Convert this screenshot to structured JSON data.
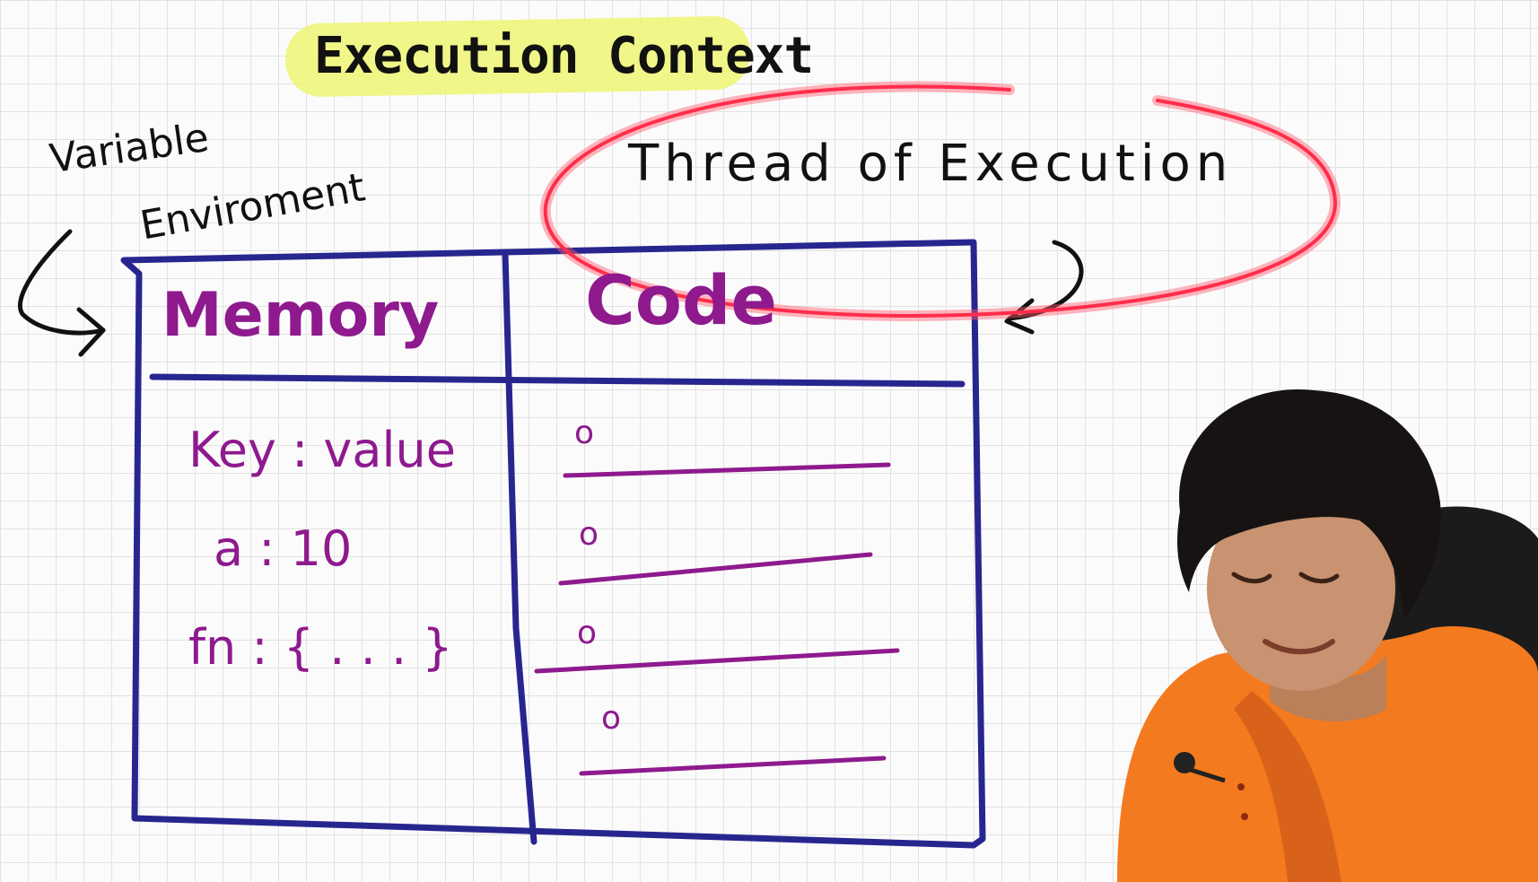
{
  "title": "Execution Context",
  "variable_environment": {
    "line1": "Variable",
    "line2": "Enviroment"
  },
  "thread_of_execution": "Thread of Execution",
  "table": {
    "memory_header": "Memory",
    "code_header": "Code",
    "memory_rows": [
      "Key : value",
      "a : 10",
      "fn : { . . . }"
    ],
    "code_markers": [
      "o",
      "o",
      "o",
      "o"
    ]
  },
  "colors": {
    "ink_blue": "#27268f",
    "ink_purple": "#8e1a8e",
    "highlight": "#eef57a",
    "red_circle": "#ff2d4a",
    "kurta_orange": "#f47a1f"
  }
}
